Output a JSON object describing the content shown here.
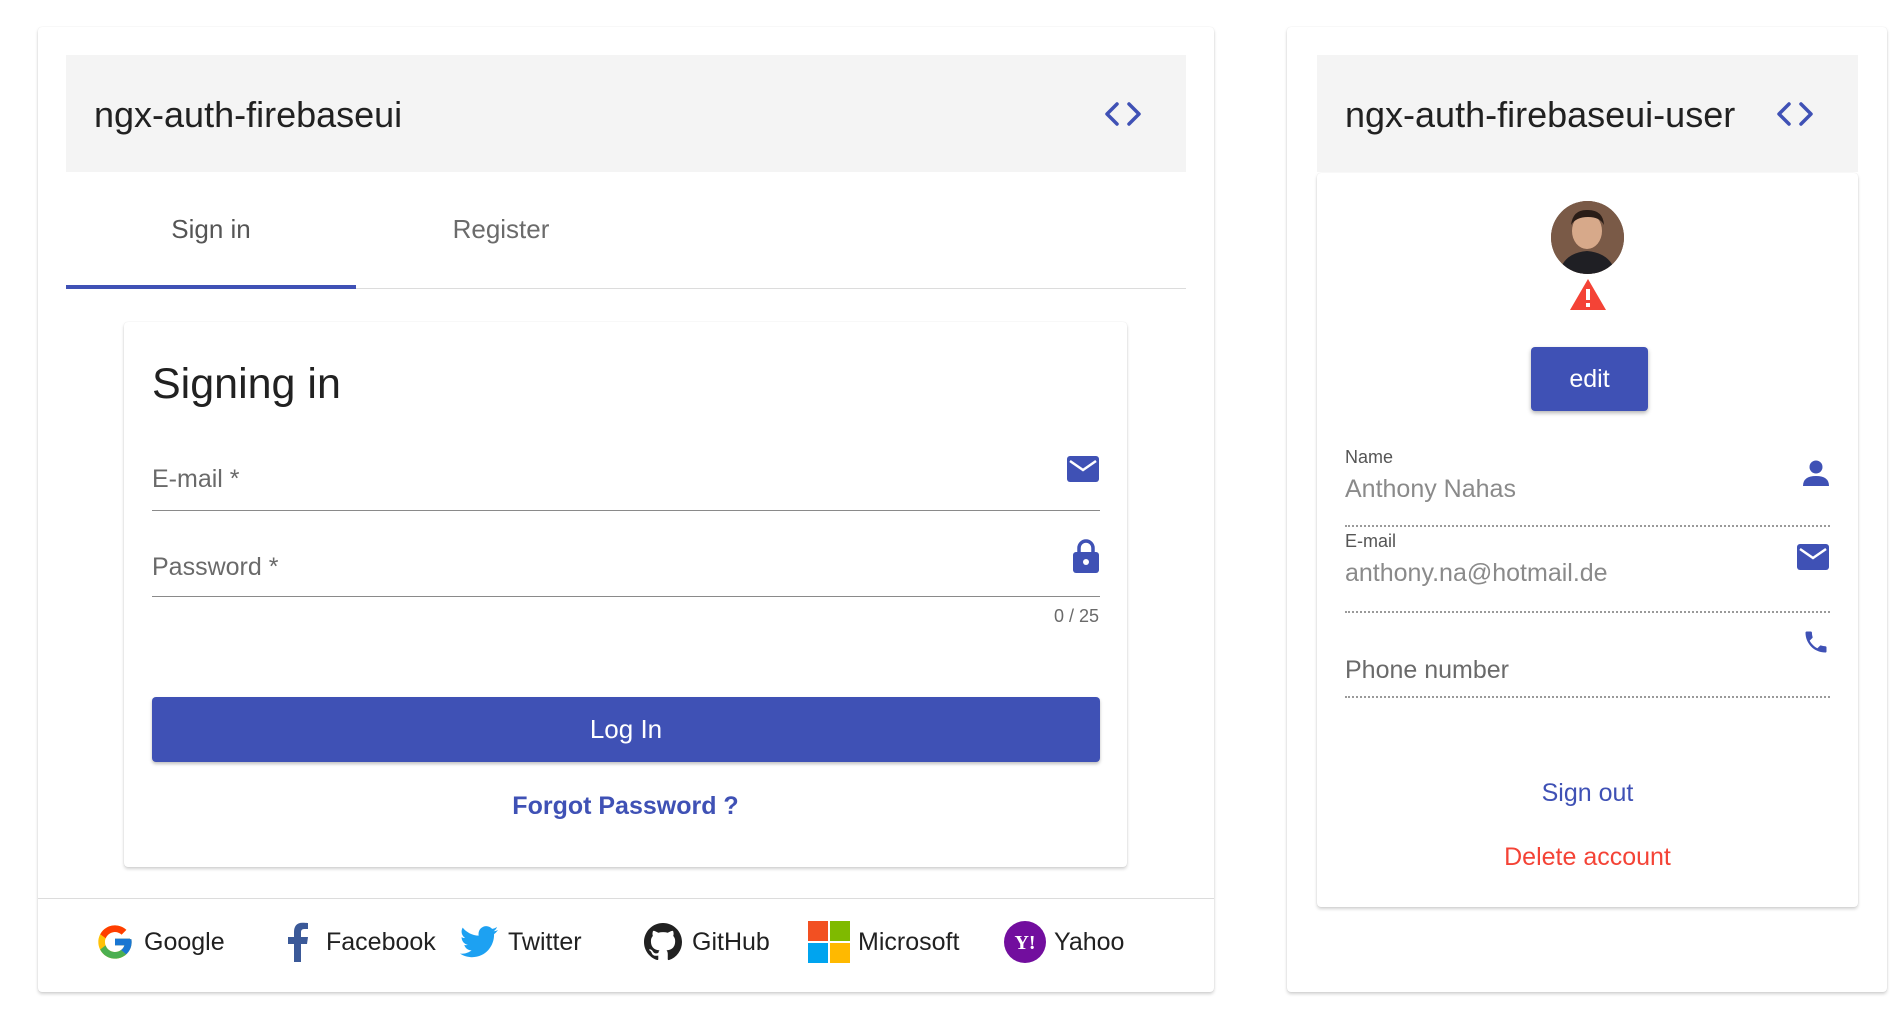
{
  "left_panel": {
    "title": "ngx-auth-firebaseui",
    "tabs": [
      {
        "label": "Sign in",
        "active": true
      },
      {
        "label": "Register",
        "active": false
      }
    ],
    "signin": {
      "heading": "Signing in",
      "email_label": "E-mail *",
      "password_label": "Password *",
      "password_counter": "0 / 25",
      "login_label": "Log In",
      "forgot_label": "Forgot Password ?"
    },
    "providers": [
      {
        "label": "Google",
        "icon": "google-icon"
      },
      {
        "label": "Facebook",
        "icon": "facebook-icon"
      },
      {
        "label": "Twitter",
        "icon": "twitter-icon"
      },
      {
        "label": "GitHub",
        "icon": "github-icon"
      },
      {
        "label": "Microsoft",
        "icon": "microsoft-icon"
      },
      {
        "label": "Yahoo",
        "icon": "yahoo-icon"
      }
    ]
  },
  "right_panel": {
    "title": "ngx-auth-firebaseui-user",
    "edit_label": "edit",
    "name": {
      "label": "Name",
      "value": "Anthony Nahas"
    },
    "email": {
      "label": "E-mail",
      "value": "anthony.na@hotmail.de"
    },
    "phone": {
      "placeholder": "Phone number"
    },
    "sign_out_label": "Sign out",
    "delete_label": "Delete account"
  },
  "colors": {
    "primary": "#3f51b5",
    "warn": "#f44336",
    "header_bg": "#f4f4f4"
  }
}
